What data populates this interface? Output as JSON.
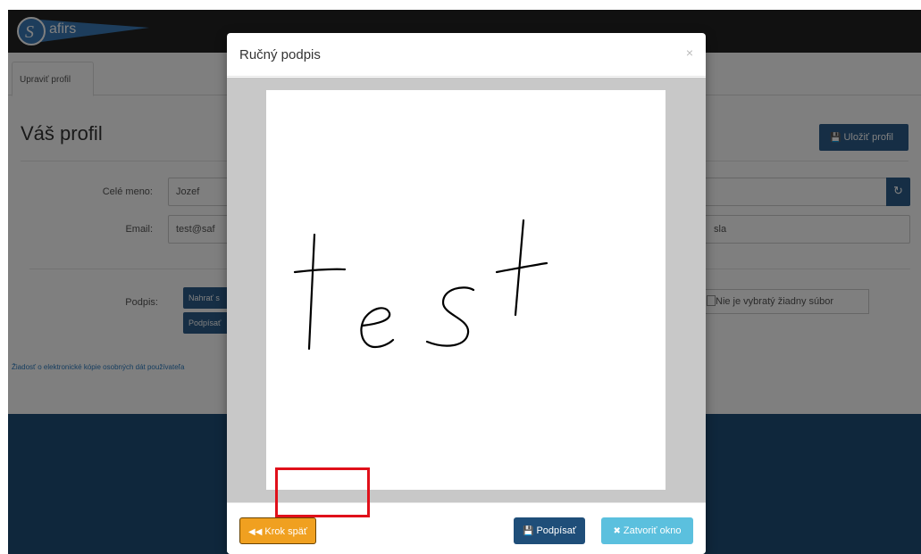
{
  "app": {
    "logo_text": "afirs",
    "tab_label": "Upraviť profil",
    "page_title": "Váš profil",
    "save_profile_label": "Uložiť profil",
    "fields": {
      "full_name_label": "Celé meno:",
      "full_name_value": "Jozef",
      "email_label": "Email:",
      "email_value": "test@saf",
      "email_right_value": "sla"
    },
    "signature": {
      "label": "Podpis:",
      "upload_button": "Nahrať s",
      "sign_button": "Podpísať",
      "file_status": "Nie je vybratý žiadny súbor"
    },
    "link_text": "Žiadosť o elektronické kópie osobných dát používateľa"
  },
  "modal": {
    "title": "Ručný podpis",
    "close_glyph": "×",
    "canvas_signature_text": "test",
    "buttons": {
      "back": "Krok späť",
      "sign": "Podpísať",
      "close": "Zatvoriť okno"
    }
  },
  "colors": {
    "primary": "#1f4e79",
    "warning": "#f0a020",
    "info": "#5bc0de",
    "highlight": "#e0101a"
  },
  "icons": {
    "back": "double-chevron-left-icon",
    "sign": "save-icon",
    "close": "close-icon",
    "refresh": "refresh-icon"
  }
}
